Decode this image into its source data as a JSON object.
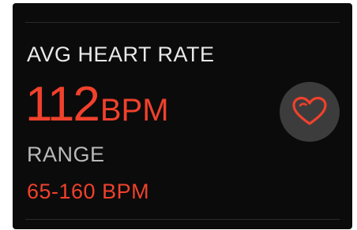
{
  "workout_metric": {
    "title": "AVG HEART RATE",
    "value": "112",
    "unit": "BPM",
    "range_label": "RANGE",
    "range_value": "65-160 BPM"
  },
  "heart_button": {
    "icon": "heart-icon"
  },
  "colors": {
    "background": "#0b0b0b",
    "accent_red": "#f0412c",
    "primary_text": "#e9e9e9",
    "secondary_text": "#b9b9b9",
    "button_bg": "#3c3c3c"
  }
}
